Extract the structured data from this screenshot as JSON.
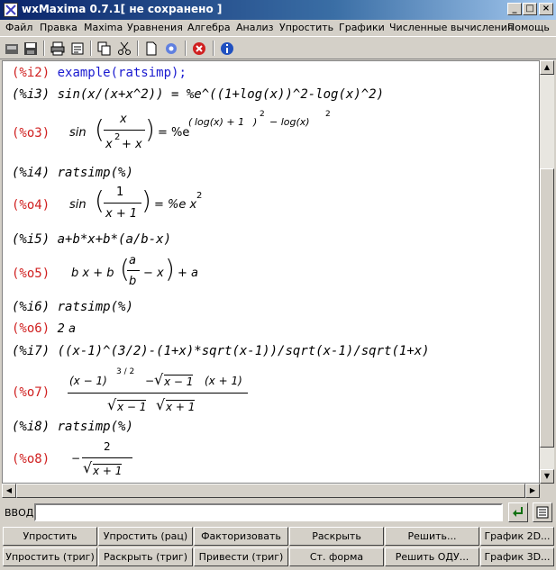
{
  "window": {
    "title": "wxMaxima 0.7.1[ не сохранено ]"
  },
  "menu": [
    "Файл",
    "Правка",
    "Maxima",
    "Уравнения",
    "Алгебра",
    "Анализ",
    "Упростить",
    "Графики",
    "Численные вычисления",
    "Помощь"
  ],
  "toolbar": [
    "open-icon",
    "save-icon",
    "print-icon",
    "config-icon",
    "copy-icon",
    "cut-icon",
    "new-icon",
    "settings-icon",
    "stop-icon",
    "info-icon"
  ],
  "worksheet": {
    "i2": {
      "label": "(%i2)",
      "code": "example(ratsimp);"
    },
    "i3": {
      "label": "(%i3)",
      "code": "sin(x/(x+x^2)) = %e^((1+log(x))^2-log(x)^2)"
    },
    "o3": {
      "label": "(%o3)",
      "sin": "sin",
      "num": "x",
      "den_a": "x",
      "den_exp": "2",
      "den_b": "+ x",
      "eq": "= %e",
      "exp_a": "log(x) + 1",
      "exp_p1": "2",
      "exp_mid": "− log(x)",
      "exp_p2": "2"
    },
    "i4": {
      "label": "(%i4)",
      "code": "ratsimp(%)"
    },
    "o4": {
      "label": "(%o4)",
      "sin": "sin",
      "num": "1",
      "den": "x + 1",
      "eq": "= %e x",
      "exp": "2"
    },
    "i5": {
      "label": "(%i5)",
      "code": "a+b*x+b*(a/b-x)"
    },
    "o5": {
      "label": "(%o5)",
      "pre": "b x + b",
      "num": "a",
      "den": "b",
      "mid": "− x",
      "post": "+ a"
    },
    "i6": {
      "label": "(%i6)",
      "code": "ratsimp(%)"
    },
    "o6": {
      "label": "(%o6)",
      "value": "2 a"
    },
    "i7": {
      "label": "(%i7)",
      "code": "((x-1)^(3/2)-(1+x)*sqrt(x-1))/sqrt(x-1)/sqrt(1+x)"
    },
    "o7": {
      "label": "(%o7)",
      "num_a": "(x − 1)",
      "num_exp": "3 / 2",
      "num_minus": "−",
      "num_rad": "x − 1",
      "num_tail": "(x + 1)",
      "den_r1": "x − 1",
      "den_r2": "x + 1"
    },
    "i8": {
      "label": "(%i8)",
      "code": "ratsimp(%)"
    },
    "o8": {
      "label": "(%o8)",
      "minus": "−",
      "num": "2",
      "den_rad": "x + 1"
    }
  },
  "input": {
    "label": "ВВОД:",
    "value": ""
  },
  "buttons_row1": [
    "Упростить",
    "Упростить (рац)",
    "Факторизовать",
    "Раскрыть",
    "Решить...",
    "График 2D..."
  ],
  "buttons_row2": [
    "Упростить (триг)",
    "Раскрыть (триг)",
    "Привести (триг)",
    "Ст. форма",
    "Решить ОДУ...",
    "График 3D..."
  ]
}
